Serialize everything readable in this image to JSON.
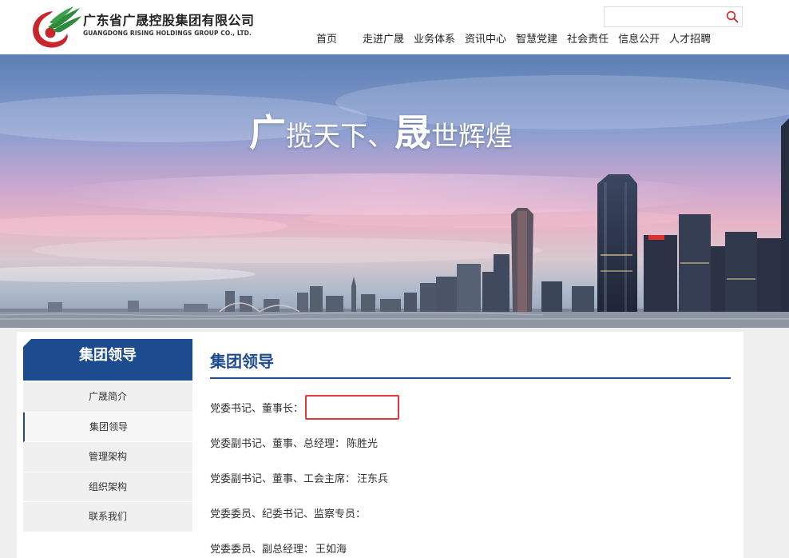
{
  "header": {
    "company_cn": "广东省广晟控股集团有限公司",
    "company_en": "GUANGDONG RISING HOLDINGS GROUP CO., LTD.",
    "search_value": "",
    "nav": [
      "首页",
      "走进广晟",
      "业务体系",
      "资讯中心",
      "智慧党建",
      "社会责任",
      "信息公开",
      "人才招聘"
    ]
  },
  "banner": {
    "slogan_1_big": "广",
    "slogan_1_rest": "揽天下、",
    "slogan_2_big": "晟",
    "slogan_2_rest": "世辉煌"
  },
  "sidebar": {
    "title": "集团领导",
    "items": [
      "广晟简介",
      "集团领导",
      "管理架构",
      "组织架构",
      "联系我们"
    ],
    "active_index": 1
  },
  "main": {
    "title": "集团领导",
    "leaders": [
      {
        "role": "党委书记、董事长：",
        "name": ""
      },
      {
        "role": "党委副书记、董事、总经理：",
        "name": "陈胜光"
      },
      {
        "role": "党委副书记、董事、工会主席：",
        "name": "汪东兵"
      },
      {
        "role": "党委委员、纪委书记、监察专员：",
        "name": ""
      },
      {
        "role": "党委委员、副总经理：",
        "name": "王如海"
      }
    ]
  },
  "colors": {
    "brand_blue": "#1c4b8f",
    "logo_red": "#c8262c",
    "logo_green": "#2e8b3d",
    "highlight_red": "#e53935"
  },
  "icons": {
    "search": "search-icon",
    "logo": "company-logo"
  }
}
